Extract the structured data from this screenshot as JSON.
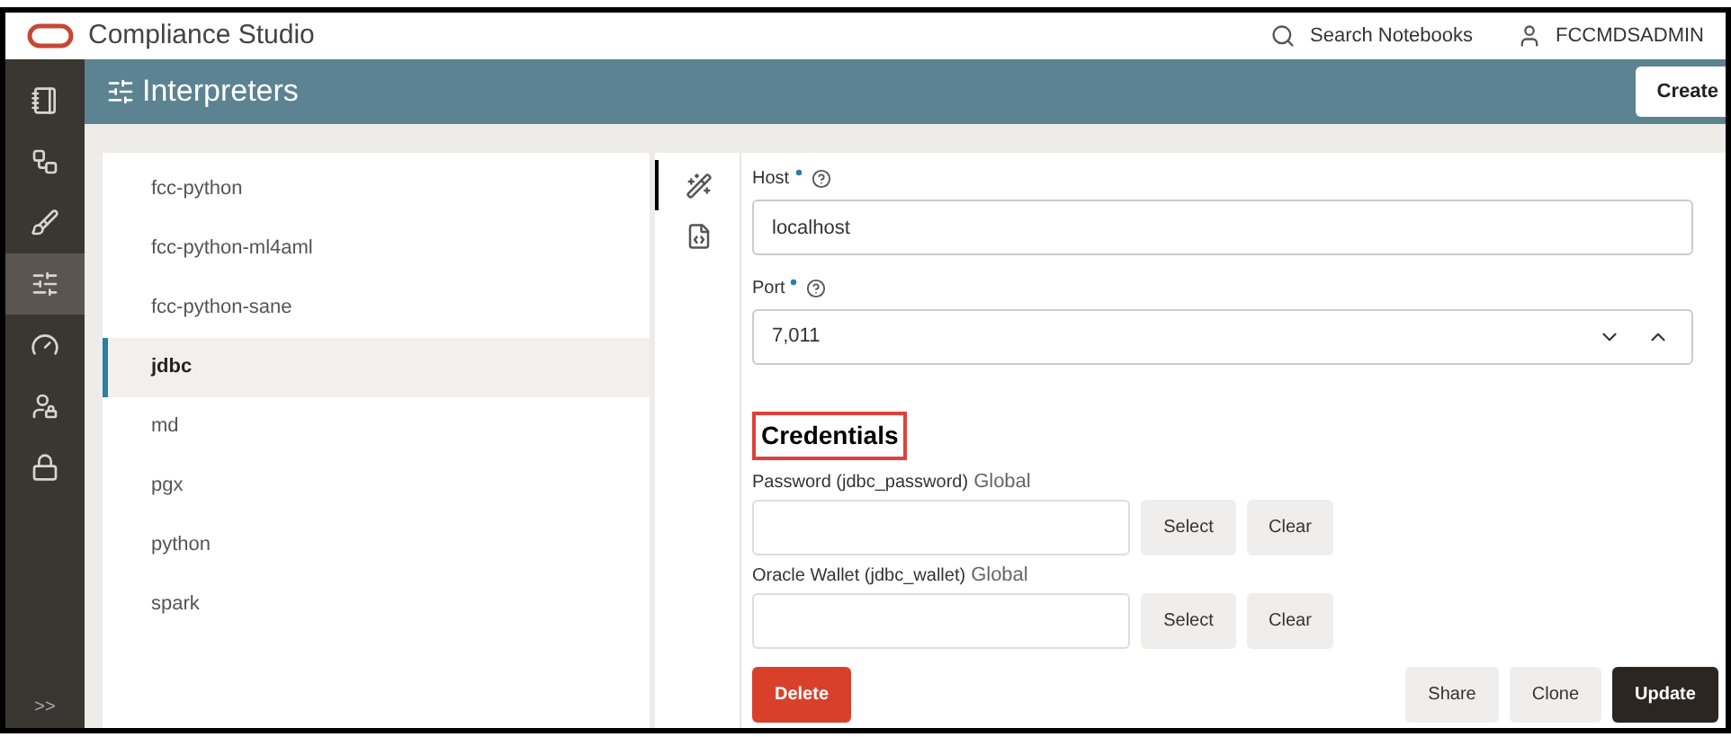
{
  "header": {
    "app_title": "Compliance Studio",
    "search_label": "Search Notebooks",
    "user": "FCCMDSADMIN"
  },
  "nav": {
    "items": [
      {
        "kind": "notebook",
        "selected": false
      },
      {
        "kind": "graph",
        "selected": false
      },
      {
        "kind": "brush",
        "selected": false
      },
      {
        "kind": "sliders",
        "selected": true
      },
      {
        "kind": "gauge",
        "selected": false
      },
      {
        "kind": "user-lock",
        "selected": false
      },
      {
        "kind": "lock",
        "selected": false
      }
    ],
    "expand": ">>"
  },
  "banner": {
    "title": "Interpreters",
    "create_button": "Create"
  },
  "interpreters": [
    {
      "name": "fcc-python",
      "selected": false
    },
    {
      "name": "fcc-python-ml4aml",
      "selected": false
    },
    {
      "name": "fcc-python-sane",
      "selected": false
    },
    {
      "name": "jdbc",
      "selected": true
    },
    {
      "name": "md",
      "selected": false
    },
    {
      "name": "pgx",
      "selected": false
    },
    {
      "name": "python",
      "selected": false
    },
    {
      "name": "spark",
      "selected": false
    }
  ],
  "tools": [
    {
      "kind": "wizard",
      "selected": true
    },
    {
      "kind": "code",
      "selected": false
    }
  ],
  "fields": [
    {
      "kind": "text",
      "label": "Host",
      "required": true,
      "value": "localhost"
    },
    {
      "kind": "number",
      "label": "Port",
      "required": true,
      "value": "7,011"
    }
  ],
  "credentials": {
    "title": "Credentials",
    "highlighted": true,
    "items": [
      {
        "label": "Password (jdbc_password)",
        "scope": "Global",
        "select": "Select",
        "clear": "Clear"
      },
      {
        "label": "Oracle Wallet (jdbc_wallet)",
        "scope": "Global",
        "select": "Select",
        "clear": "Clear"
      }
    ]
  },
  "actions": {
    "delete": "Delete",
    "share": "Share",
    "clone": "Clone",
    "update": "Update"
  }
}
